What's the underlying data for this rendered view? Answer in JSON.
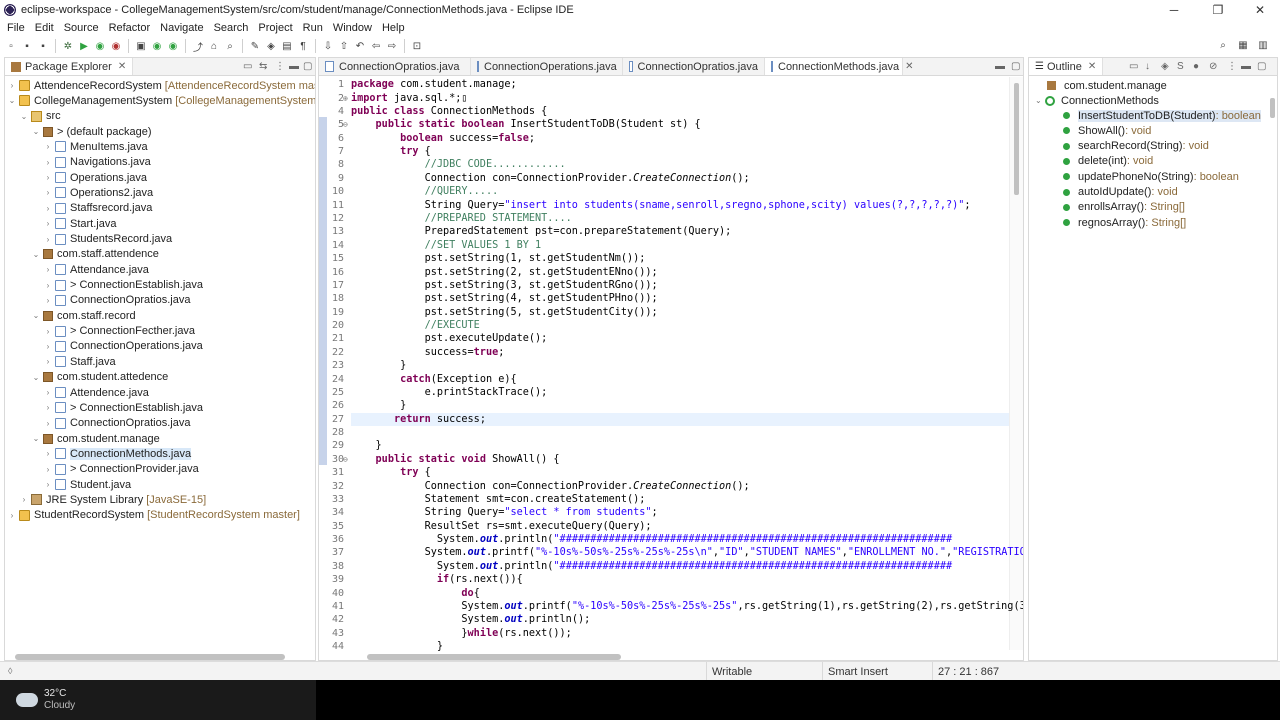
{
  "window": {
    "title": "eclipse-workspace - CollegeManagementSystem/src/com/student/manage/ConnectionMethods.java - Eclipse IDE",
    "controls": [
      "─",
      "❐",
      "✕"
    ]
  },
  "menu": [
    "File",
    "Edit",
    "Source",
    "Refactor",
    "Navigate",
    "Search",
    "Project",
    "Run",
    "Window",
    "Help"
  ],
  "package_explorer": {
    "title": "Package Explorer",
    "items": [
      {
        "label": "AttendenceRecordSystem",
        "repo": "[AttendenceRecordSystem master]",
        "icon": "project",
        "twist": "›"
      },
      {
        "label": "CollegeManagementSystem",
        "repo": "[CollegeManagementSystem mas",
        "icon": "project",
        "twist": "⌄"
      },
      {
        "label": "src",
        "repo": "",
        "icon": "folder",
        "twist": "⌄"
      },
      {
        "label": "> (default package)",
        "repo": "",
        "icon": "pkg",
        "twist": "⌄"
      },
      {
        "label": "MenuItems.java",
        "repo": "",
        "icon": "java",
        "twist": "›"
      },
      {
        "label": "Navigations.java",
        "repo": "",
        "icon": "java",
        "twist": "›"
      },
      {
        "label": "Operations.java",
        "repo": "",
        "icon": "java",
        "twist": "›"
      },
      {
        "label": "Operations2.java",
        "repo": "",
        "icon": "java",
        "twist": "›"
      },
      {
        "label": "Staffsrecord.java",
        "repo": "",
        "icon": "java",
        "twist": "›"
      },
      {
        "label": "Start.java",
        "repo": "",
        "icon": "java",
        "twist": "›"
      },
      {
        "label": "StudentsRecord.java",
        "repo": "",
        "icon": "java",
        "twist": "›"
      },
      {
        "label": "com.staff.attendence",
        "repo": "",
        "icon": "pkg",
        "twist": "⌄"
      },
      {
        "label": "Attendance.java",
        "repo": "",
        "icon": "java",
        "twist": "›"
      },
      {
        "label": "> ConnectionEstablish.java",
        "repo": "",
        "icon": "java",
        "twist": "›"
      },
      {
        "label": "ConnectionOpratios.java",
        "repo": "",
        "icon": "java",
        "twist": "›"
      },
      {
        "label": "com.staff.record",
        "repo": "",
        "icon": "pkg",
        "twist": "⌄"
      },
      {
        "label": "> ConnectionFecther.java",
        "repo": "",
        "icon": "java",
        "twist": "›"
      },
      {
        "label": "ConnectionOperations.java",
        "repo": "",
        "icon": "java",
        "twist": "›"
      },
      {
        "label": "Staff.java",
        "repo": "",
        "icon": "java",
        "twist": "›"
      },
      {
        "label": "com.student.attedence",
        "repo": "",
        "icon": "pkg",
        "twist": "⌄"
      },
      {
        "label": "Attendence.java",
        "repo": "",
        "icon": "java",
        "twist": "›"
      },
      {
        "label": "> ConnectionEstablish.java",
        "repo": "",
        "icon": "java",
        "twist": "›"
      },
      {
        "label": "ConnectionOpratios.java",
        "repo": "",
        "icon": "java",
        "twist": "›"
      },
      {
        "label": "com.student.manage",
        "repo": "",
        "icon": "pkg",
        "twist": "⌄"
      },
      {
        "label": "ConnectionMethods.java",
        "repo": "",
        "icon": "java",
        "twist": "›",
        "selected": true
      },
      {
        "label": "> ConnectionProvider.java",
        "repo": "",
        "icon": "java",
        "twist": "›"
      },
      {
        "label": "Student.java",
        "repo": "",
        "icon": "java",
        "twist": "›"
      },
      {
        "label": "JRE System Library",
        "repo": "[JavaSE-15]",
        "icon": "lib",
        "twist": "›"
      },
      {
        "label": "StudentRecordSystem",
        "repo": "[StudentRecordSystem master]",
        "icon": "project",
        "twist": "›"
      }
    ]
  },
  "editor": {
    "tabs": [
      {
        "label": "ConnectionOpratios.java",
        "active": false
      },
      {
        "label": "ConnectionOperations.java",
        "active": false
      },
      {
        "label": "ConnectionOpratios.java",
        "active": false
      },
      {
        "label": "ConnectionMethods.java",
        "active": true
      }
    ],
    "lines": [
      {
        "n": "1",
        "html": "<span class=\"kw\">package</span> com.student.manage;"
      },
      {
        "n": "2",
        "fold": "⊕",
        "html": "<span class=\"kw\">import</span> java.sql.*;▯"
      },
      {
        "n": "4",
        "html": "<span class=\"kw\">public class</span> ConnectionMethods {"
      },
      {
        "n": "5",
        "fold": "⊖",
        "html": "    <span class=\"kw\">public static boolean</span> InsertStudentToDB(Student st) {"
      },
      {
        "n": "6",
        "html": "        <span class=\"kw\">boolean</span> success=<span class=\"kw\">false</span>;"
      },
      {
        "n": "7",
        "html": "        <span class=\"kw\">try</span> {"
      },
      {
        "n": "8",
        "html": "            <span class=\"cm\">//JDBC CODE............</span>"
      },
      {
        "n": "9",
        "html": "            Connection con=ConnectionProvider.<span class=\"it\">CreateConnection</span>();"
      },
      {
        "n": "10",
        "html": "            <span class=\"cm\">//QUERY.....</span>"
      },
      {
        "n": "11",
        "html": "            String Query=<span class=\"st\">\"insert into students(sname,senroll,sregno,sphone,scity) values(?,?,?,?,?)\"</span>;"
      },
      {
        "n": "12",
        "html": "            <span class=\"cm\">//PREPARED STATEMENT....</span>"
      },
      {
        "n": "13",
        "html": "            PreparedStatement pst=con.prepareStatement(Query);"
      },
      {
        "n": "14",
        "html": "            <span class=\"cm\">//SET VALUES 1 BY 1</span>"
      },
      {
        "n": "15",
        "html": "            pst.setString(1, st.getStudentNm());"
      },
      {
        "n": "16",
        "html": "            pst.setString(2, st.getStudentENno());"
      },
      {
        "n": "17",
        "html": "            pst.setString(3, st.getStudentRGno());"
      },
      {
        "n": "18",
        "html": "            pst.setString(4, st.getStudentPHno());"
      },
      {
        "n": "19",
        "html": "            pst.setString(5, st.getStudentCity());"
      },
      {
        "n": "20",
        "html": "            <span class=\"cm\">//EXECUTE</span>"
      },
      {
        "n": "21",
        "html": "            pst.executeUpdate();"
      },
      {
        "n": "22",
        "html": "            success=<span class=\"kw\">true</span>;"
      },
      {
        "n": "23",
        "html": "        }"
      },
      {
        "n": "24",
        "html": "        <span class=\"kw\">catch</span>(Exception e){"
      },
      {
        "n": "25",
        "html": "            e.printStackTrace();"
      },
      {
        "n": "26",
        "html": "        }"
      },
      {
        "n": "27",
        "current": true,
        "html": "       <span class=\"kw\">return</span> success;"
      },
      {
        "n": "28",
        "html": ""
      },
      {
        "n": "29",
        "html": "    }"
      },
      {
        "n": "30",
        "fold": "⊖",
        "html": "    <span class=\"kw\">public static void</span> ShowAll() {"
      },
      {
        "n": "31",
        "html": "        <span class=\"kw\">try</span> {"
      },
      {
        "n": "32",
        "html": "            Connection con=ConnectionProvider.<span class=\"it\">CreateConnection</span>();"
      },
      {
        "n": "33",
        "html": "            Statement smt=con.createStatement();"
      },
      {
        "n": "34",
        "html": "            String Query=<span class=\"st\">\"select * from students\"</span>;"
      },
      {
        "n": "35",
        "html": "            ResultSet rs=smt.executeQuery(Query);"
      },
      {
        "n": "36",
        "html": "              System.<span class=\"fld\">out</span>.println(<span class=\"st\">\"################################################################</span>"
      },
      {
        "n": "37",
        "html": "            System.<span class=\"fld\">out</span>.printf(<span class=\"st\">\"%-10s%-50s%-25s%-25s%-25s\\n\"</span>,<span class=\"st\">\"ID\"</span>,<span class=\"st\">\"STUDENT NAMES\"</span>,<span class=\"st\">\"ENROLLMENT NO.\"</span>,<span class=\"st\">\"REGISTRATIO</span>"
      },
      {
        "n": "38",
        "html": "              System.<span class=\"fld\">out</span>.println(<span class=\"st\">\"################################################################</span>"
      },
      {
        "n": "39",
        "html": "              <span class=\"kw\">if</span>(rs.next()){"
      },
      {
        "n": "40",
        "html": "                  <span class=\"kw\">do</span>{"
      },
      {
        "n": "41",
        "html": "                  System.<span class=\"fld\">out</span>.printf(<span class=\"st\">\"%-10s%-50s%-25s%-25s%-25s\"</span>,rs.getString(1),rs.getString(2),rs.getString(3"
      },
      {
        "n": "42",
        "html": "                  System.<span class=\"fld\">out</span>.println();"
      },
      {
        "n": "43",
        "html": "                  }<span class=\"kw\">while</span>(rs.next());"
      },
      {
        "n": "44",
        "html": "              }"
      }
    ]
  },
  "outline": {
    "title": "Outline",
    "package": "com.student.manage",
    "class": "ConnectionMethods",
    "methods": [
      {
        "sig": "InsertStudentToDB(Student)",
        "ret": " : boolean",
        "selected": true
      },
      {
        "sig": "ShowAll()",
        "ret": " : void"
      },
      {
        "sig": "searchRecord(String)",
        "ret": " : void"
      },
      {
        "sig": "delete(int)",
        "ret": " : void"
      },
      {
        "sig": "updatePhoneNo(String)",
        "ret": " : boolean"
      },
      {
        "sig": "autoIdUpdate()",
        "ret": " : void"
      },
      {
        "sig": "enrollsArray()",
        "ret": " : String[]"
      },
      {
        "sig": "regnosArray()",
        "ret": " : String[]"
      }
    ]
  },
  "status": {
    "mode": "Writable",
    "insert": "Smart Insert",
    "position": "27 : 21 : 867"
  },
  "taskbar": {
    "temperature": "32°C",
    "condition": "Cloudy"
  },
  "colors": {
    "keyword": "#7f0055",
    "comment": "#3f7f5f",
    "string": "#2a00ff",
    "field": "#0000c0"
  }
}
